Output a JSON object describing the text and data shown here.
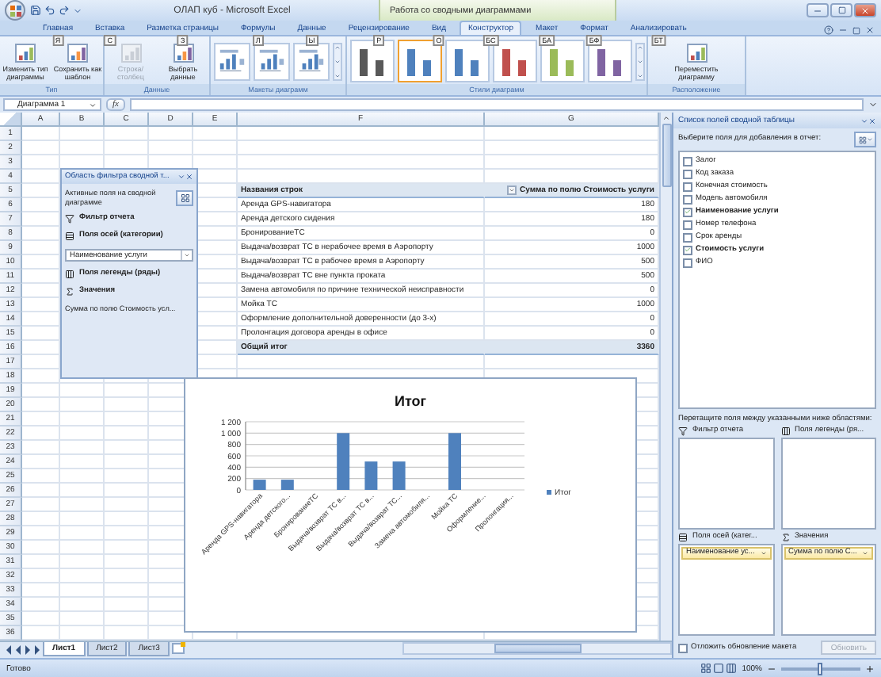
{
  "title_bar": {
    "app_title": "ОЛАП куб - Microsoft Excel",
    "context_title": "Работа со сводными диаграммами"
  },
  "tabs": [
    {
      "label": "Главная",
      "keytip": "Я",
      "selected": false
    },
    {
      "label": "Вставка",
      "keytip": "С",
      "selected": false
    },
    {
      "label": "Разметка страницы",
      "keytip": "З",
      "selected": false
    },
    {
      "label": "Формулы",
      "keytip": "Л",
      "selected": false
    },
    {
      "label": "Данные",
      "keytip": "Ы",
      "selected": false
    },
    {
      "label": "Рецензирование",
      "keytip": "Р",
      "selected": false
    },
    {
      "label": "Вид",
      "keytip": "О",
      "selected": false
    },
    {
      "label": "Конструктор",
      "keytip": "БС",
      "selected": true
    },
    {
      "label": "Макет",
      "keytip": "БА",
      "selected": false
    },
    {
      "label": "Формат",
      "keytip": "БФ",
      "selected": false
    },
    {
      "label": "Анализировать",
      "keytip": "БТ",
      "selected": false
    }
  ],
  "ribbon": {
    "groups": [
      {
        "kind": "buttons",
        "label": "Тип",
        "buttons": [
          {
            "label": "Изменить тип диаграммы",
            "disabled": false
          },
          {
            "label": "Сохранить как шаблон",
            "disabled": false
          }
        ]
      },
      {
        "kind": "buttons",
        "label": "Данные",
        "buttons": [
          {
            "label": "Строка/столбец",
            "disabled": true
          },
          {
            "label": "Выбрать данные",
            "disabled": false
          }
        ]
      },
      {
        "kind": "layouts",
        "label": "Макеты диаграмм"
      },
      {
        "kind": "styles",
        "label": "Стили диаграмм",
        "styles": [
          {
            "color": "#595959",
            "selected": false
          },
          {
            "color": "#4f81bd",
            "selected": true
          },
          {
            "color": "#4f81bd",
            "selected": false
          },
          {
            "color": "#c0504d",
            "selected": false
          },
          {
            "color": "#9bbb59",
            "selected": false
          },
          {
            "color": "#8064a2",
            "selected": false
          }
        ]
      },
      {
        "kind": "buttons",
        "label": "Расположение",
        "buttons": [
          {
            "label": "Переместить диаграмму",
            "disabled": false
          }
        ]
      }
    ]
  },
  "formula_bar": {
    "name_box": "Диаграмма 1",
    "fx": "fx"
  },
  "sheet": {
    "columns": [
      "A",
      "B",
      "C",
      "D",
      "E",
      "F",
      "G"
    ],
    "row_numbers": [
      "1",
      "2",
      "3",
      "4",
      "5",
      "6",
      "7",
      "8",
      "9",
      "10",
      "11",
      "12",
      "13",
      "14",
      "15",
      "16",
      "17",
      "18",
      "19",
      "20",
      "21",
      "22",
      "23",
      "24",
      "25",
      "26",
      "27",
      "28",
      "29",
      "30",
      "31",
      "32",
      "33",
      "34",
      "35",
      "36"
    ],
    "pivot": {
      "header_label": "Названия строк",
      "header_value": "Сумма по полю Стоимость услуги",
      "rows": [
        {
          "label": "Аренда GPS-навигатора",
          "value": "180"
        },
        {
          "label": "Аренда детского сидения",
          "value": "180"
        },
        {
          "label": "БронированиеТС",
          "value": "0"
        },
        {
          "label": "Выдача/возврат ТС в нерабочее время в Аэропорту",
          "value": "1000"
        },
        {
          "label": "Выдача/возврат ТС в рабочее время в Аэропорту",
          "value": "500"
        },
        {
          "label": "Выдача/возврат ТС вне пункта проката",
          "value": "500"
        },
        {
          "label": "Замена автомобиля по причине технической неисправности",
          "value": "0"
        },
        {
          "label": "Мойка ТС",
          "value": "1000"
        },
        {
          "label": "Оформление дополнительной доверенности (до 3-х)",
          "value": "0"
        },
        {
          "label": "Пролонгация договора аренды в офисе",
          "value": "0"
        }
      ],
      "total": {
        "label": "Общий итог",
        "value": "3360"
      }
    }
  },
  "filter_pane": {
    "title": "Область фильтра сводной т...",
    "active_label": "Активные поля на сводной диаграмме",
    "sections": [
      {
        "kind": "filter",
        "label": "Фильтр отчета"
      },
      {
        "kind": "axis",
        "label": "Поля осей (категории)",
        "field": "Наименование услуги"
      },
      {
        "kind": "legend",
        "label": "Поля легенды (ряды)"
      },
      {
        "kind": "values",
        "label": "Значения",
        "field": "Сумма по полю Стоимость усл..."
      }
    ]
  },
  "chart": {
    "chart_data": {
      "type": "bar",
      "title": "Итог",
      "categories": [
        "Аренда GPS-навигатора",
        "Аренда детского...",
        "БронированиеТС",
        "Выдача/возврат ТС в...",
        "Выдача/возврат ТС в...",
        "Выдача/возврат ТС...",
        "Замена автомобиля...",
        "Мойка ТС",
        "Оформление...",
        "Пролонгация..."
      ],
      "series": [
        {
          "name": "Итог",
          "color": "#4f81bd",
          "values": [
            180,
            180,
            0,
            1000,
            500,
            500,
            0,
            1000,
            0,
            0
          ]
        }
      ],
      "ylim": [
        0,
        1200
      ],
      "grid": true,
      "yticks": [
        {
          "value": 0,
          "label": "0"
        },
        {
          "value": 200,
          "label": "200"
        },
        {
          "value": 400,
          "label": "400"
        },
        {
          "value": 600,
          "label": "600"
        },
        {
          "value": 800,
          "label": "800"
        },
        {
          "value": 1000,
          "label": "1 000"
        },
        {
          "value": 1200,
          "label": "1 200"
        }
      ]
    }
  },
  "sheet_tabs": [
    {
      "label": "Лист1",
      "selected": true
    },
    {
      "label": "Лист2",
      "selected": false
    },
    {
      "label": "Лист3",
      "selected": false
    }
  ],
  "field_list": {
    "title": "Список полей сводной таблицы",
    "prompt": "Выберите поля для добавления в отчет:",
    "fields": [
      {
        "label": "Залог",
        "checked": false
      },
      {
        "label": "Код заказа",
        "checked": false
      },
      {
        "label": "Конечная стоимость",
        "checked": false
      },
      {
        "label": "Модель автомобиля",
        "checked": false
      },
      {
        "label": "Наименование услуги",
        "checked": true
      },
      {
        "label": "Номер телефона",
        "checked": false
      },
      {
        "label": "Срок аренды",
        "checked": false
      },
      {
        "label": "Стоимость услуги",
        "checked": true
      },
      {
        "label": "ФИО",
        "checked": false
      }
    ],
    "drag_prompt": "Перетащите поля между указанными ниже областями:",
    "areas": [
      {
        "kind": "filter",
        "label": "Фильтр отчета"
      },
      {
        "kind": "legend",
        "label": "Поля легенды (ря..."
      },
      {
        "kind": "axis",
        "label": "Поля осей (катег...",
        "items": [
          "Наименование ус..."
        ]
      },
      {
        "kind": "values",
        "label": "Значения",
        "items": [
          "Сумма по полю С..."
        ]
      }
    ],
    "defer": {
      "label": "Отложить обновление макета",
      "checked": false
    },
    "update_button": {
      "label": "Обновить",
      "disabled": true
    }
  },
  "status_bar": {
    "status": "Готово",
    "zoom": "100%",
    "zoom_slider": {
      "level": 0.5
    }
  }
}
